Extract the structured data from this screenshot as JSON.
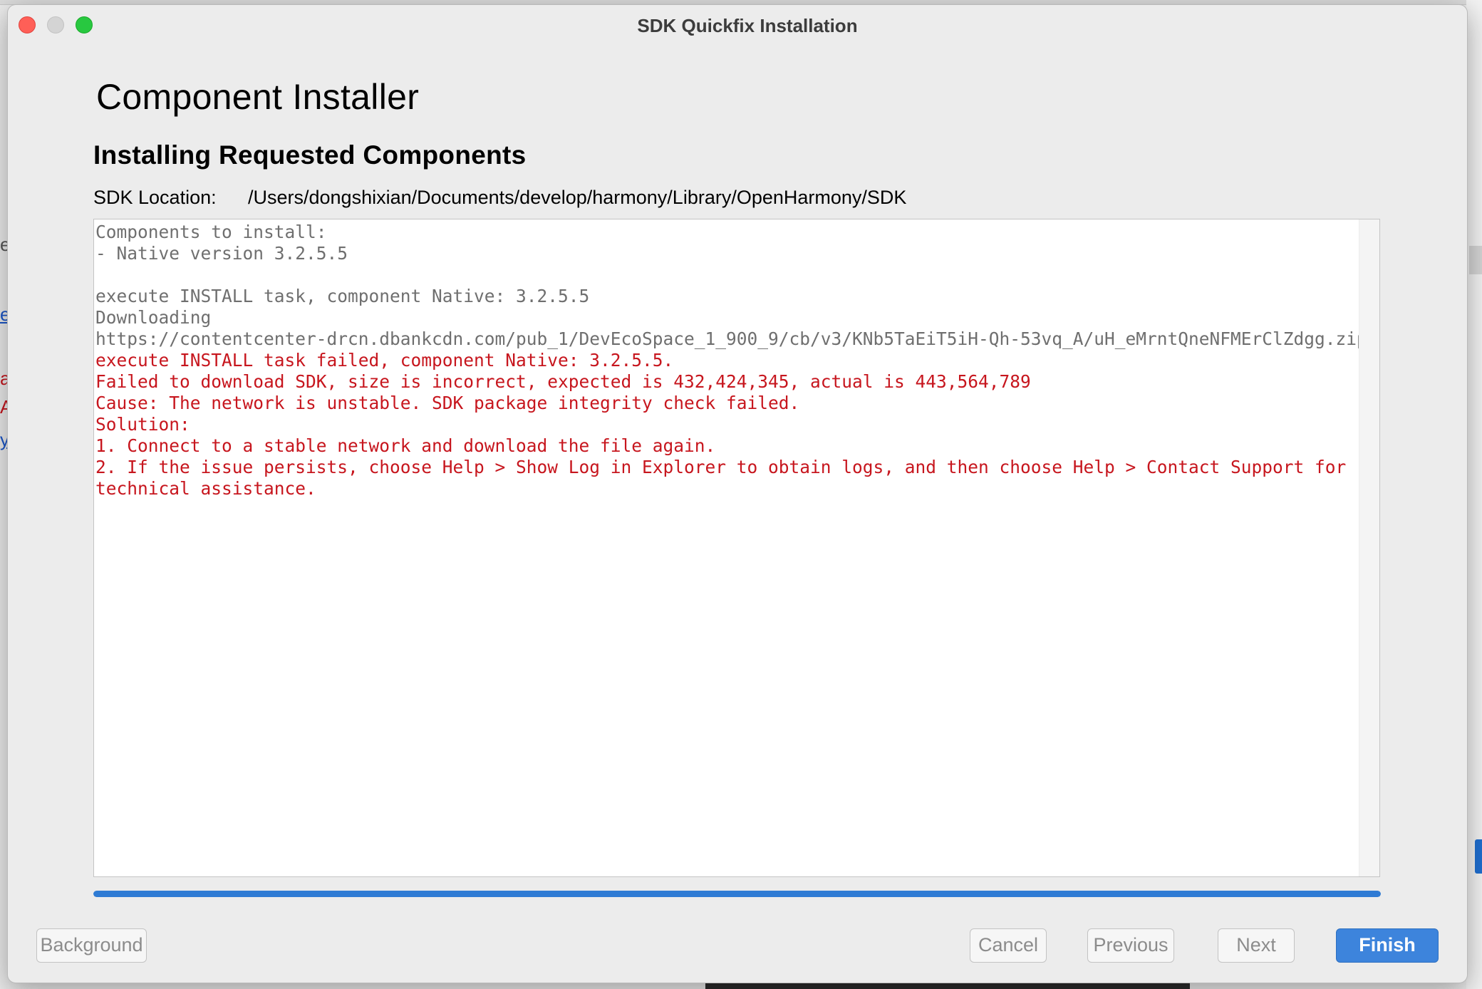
{
  "dialog": {
    "window_title": "SDK Quickfix Installation",
    "main_title": "Component Installer",
    "section_title": "Installing Requested Components",
    "sdk_location_label": "SDK Location:",
    "sdk_location_value": "/Users/dongshixian/Documents/develop/harmony/Library/OpenHarmony/SDK",
    "log_lines": [
      {
        "text": "Components to install:",
        "kind": "normal"
      },
      {
        "text": "- Native version 3.2.5.5",
        "kind": "normal"
      },
      {
        "text": "",
        "kind": "normal"
      },
      {
        "text": "execute INSTALL task, component Native: 3.2.5.5",
        "kind": "normal"
      },
      {
        "text": "Downloading",
        "kind": "normal"
      },
      {
        "text": "https://contentcenter-drcn.dbankcdn.com/pub_1/DevEcoSpace_1_900_9/cb/v3/KNb5TaEiT5iH-Qh-53vq_A/uH_eMrntQneNFMErClZdgg.zip",
        "kind": "normal"
      },
      {
        "text": "execute INSTALL task failed, component Native: 3.2.5.5.",
        "kind": "error"
      },
      {
        "text": "Failed to download SDK, size is incorrect, expected is 432,424,345, actual is 443,564,789",
        "kind": "error"
      },
      {
        "text": "Cause: The network is unstable. SDK package integrity check failed.",
        "kind": "error"
      },
      {
        "text": "Solution:",
        "kind": "error"
      },
      {
        "text": "1. Connect to a stable network and download the file again.",
        "kind": "error"
      },
      {
        "text": "2. If the issue persists, choose Help > Show Log in Explorer to obtain logs, and then choose Help > Contact Support for",
        "kind": "error"
      },
      {
        "text": "technical assistance.",
        "kind": "error"
      }
    ],
    "progress": 1.0,
    "buttons": {
      "background": "Background",
      "cancel": "Cancel",
      "previous": "Previous",
      "next": "Next",
      "finish": "Finish"
    },
    "colors": {
      "accent": "#3d84dc",
      "progress": "#2f7bd4",
      "error_text": "#c7161e",
      "log_text": "#6f6f6f"
    }
  }
}
